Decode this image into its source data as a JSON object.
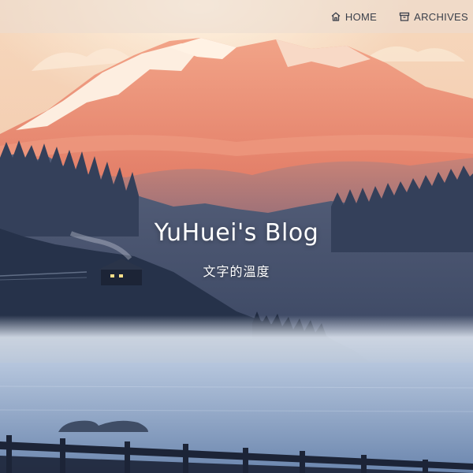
{
  "nav": {
    "items": [
      {
        "label": "HOME",
        "icon": "home-icon"
      },
      {
        "label": "ARCHIVES",
        "icon": "archive-icon"
      }
    ]
  },
  "site": {
    "title": "YuHuei's Blog",
    "subtitle": "文字的溫度"
  },
  "colors": {
    "sky": "#f3c7a8",
    "mountain": "#e9967a",
    "forest": "#2b3a52",
    "lake": "#9fb3cf",
    "nav_text": "#3a3f4a"
  }
}
